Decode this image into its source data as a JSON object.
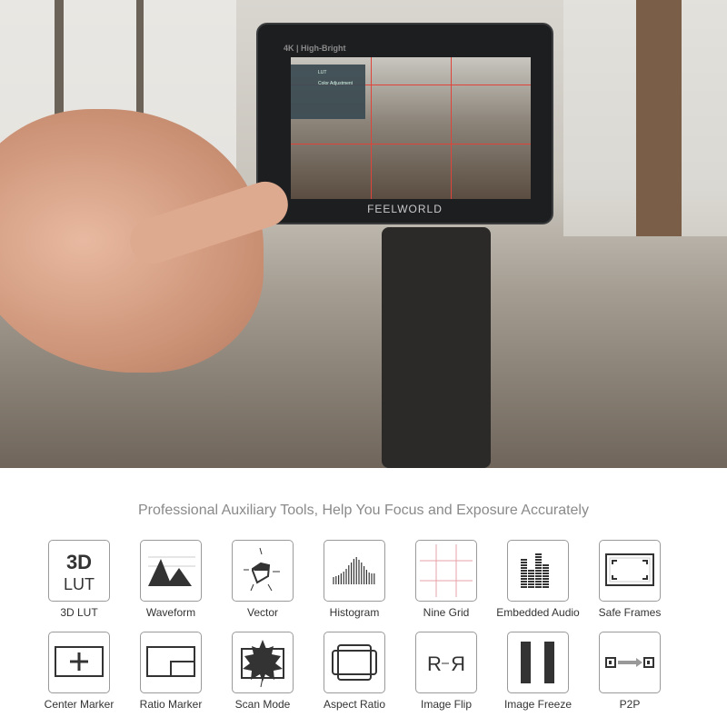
{
  "monitor": {
    "brand_line": "4K | High-Bright",
    "logo": "FEELWORLD",
    "menu_items": [
      "LUT",
      "Color Adjustment"
    ]
  },
  "title": "Professional Auxiliary Tools, Help You Focus and Exposure Accurately",
  "tools": [
    {
      "label": "3D LUT",
      "icon": "3d-lut-icon",
      "icon_text_top": "3D",
      "icon_text_bottom": "LUT"
    },
    {
      "label": "Waveform",
      "icon": "waveform-icon"
    },
    {
      "label": "Vector",
      "icon": "vector-icon"
    },
    {
      "label": "Histogram",
      "icon": "histogram-icon"
    },
    {
      "label": "Nine Grid",
      "icon": "nine-grid-icon"
    },
    {
      "label": "Embedded Audio",
      "icon": "audio-meter-icon"
    },
    {
      "label": "Safe Frames",
      "icon": "safe-frames-icon"
    },
    {
      "label": "Center Marker",
      "icon": "center-marker-icon"
    },
    {
      "label": "Ratio Marker",
      "icon": "ratio-marker-icon"
    },
    {
      "label": "Scan Mode",
      "icon": "scan-mode-leaf-icon"
    },
    {
      "label": "Aspect Ratio",
      "icon": "aspect-ratio-icon"
    },
    {
      "label": "Image Flip",
      "icon": "image-flip-icon",
      "icon_text": "R"
    },
    {
      "label": "Image Freeze",
      "icon": "pause-icon"
    },
    {
      "label": "P2P",
      "icon": "p2p-icon"
    }
  ],
  "colors": {
    "grid_red": "#e0433a",
    "nine_grid_line": "#e6a0a8",
    "title_gray": "#8a8a8a"
  }
}
